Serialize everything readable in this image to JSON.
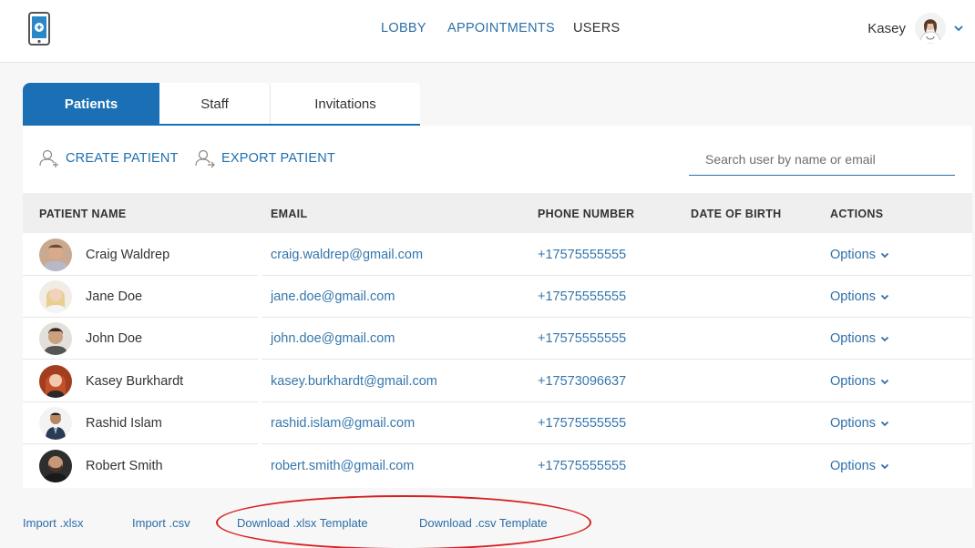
{
  "nav": {
    "lobby": "LOBBY",
    "appointments": "APPOINTMENTS",
    "users": "USERS"
  },
  "user": {
    "name": "Kasey"
  },
  "tabs": [
    {
      "label": "Patients",
      "active": true
    },
    {
      "label": "Staff",
      "active": false
    },
    {
      "label": "Invitations",
      "active": false
    }
  ],
  "actions": {
    "create": "CREATE PATIENT",
    "export": "EXPORT PATIENT"
  },
  "search": {
    "placeholder": "Search user by name or email"
  },
  "table": {
    "headers": [
      "PATIENT NAME",
      "EMAIL",
      "PHONE NUMBER",
      "DATE OF BIRTH",
      "ACTIONS"
    ],
    "rows": [
      {
        "name": "Craig Waldrep",
        "email": "craig.waldrep@gmail.com",
        "phone": "+17575555555",
        "dob": "",
        "action": "Options"
      },
      {
        "name": "Jane Doe",
        "email": "jane.doe@gmail.com",
        "phone": "+17575555555",
        "dob": "",
        "action": "Options"
      },
      {
        "name": "John Doe",
        "email": "john.doe@gmail.com",
        "phone": "+17575555555",
        "dob": "",
        "action": "Options"
      },
      {
        "name": "Kasey Burkhardt",
        "email": "kasey.burkhardt@gmail.com",
        "phone": "+17573096637",
        "dob": "",
        "action": "Options"
      },
      {
        "name": "Rashid Islam",
        "email": "rashid.islam@gmail.com",
        "phone": "+17575555555",
        "dob": "",
        "action": "Options"
      },
      {
        "name": "Robert Smith",
        "email": "robert.smith@gmail.com",
        "phone": "+17575555555",
        "dob": "",
        "action": "Options"
      }
    ]
  },
  "footer": {
    "import_xlsx": "Import .xlsx",
    "import_csv": "Import .csv",
    "download_xlsx": "Download .xlsx Template",
    "download_csv": "Download .csv Template"
  },
  "colors": {
    "accent": "#1a6fb5",
    "link": "#3576ab",
    "highlight_ellipse": "#d62020"
  },
  "icons": [
    "phone-logo-icon",
    "avatar",
    "chevron-down-icon",
    "create-patient-icon",
    "export-patient-icon"
  ]
}
